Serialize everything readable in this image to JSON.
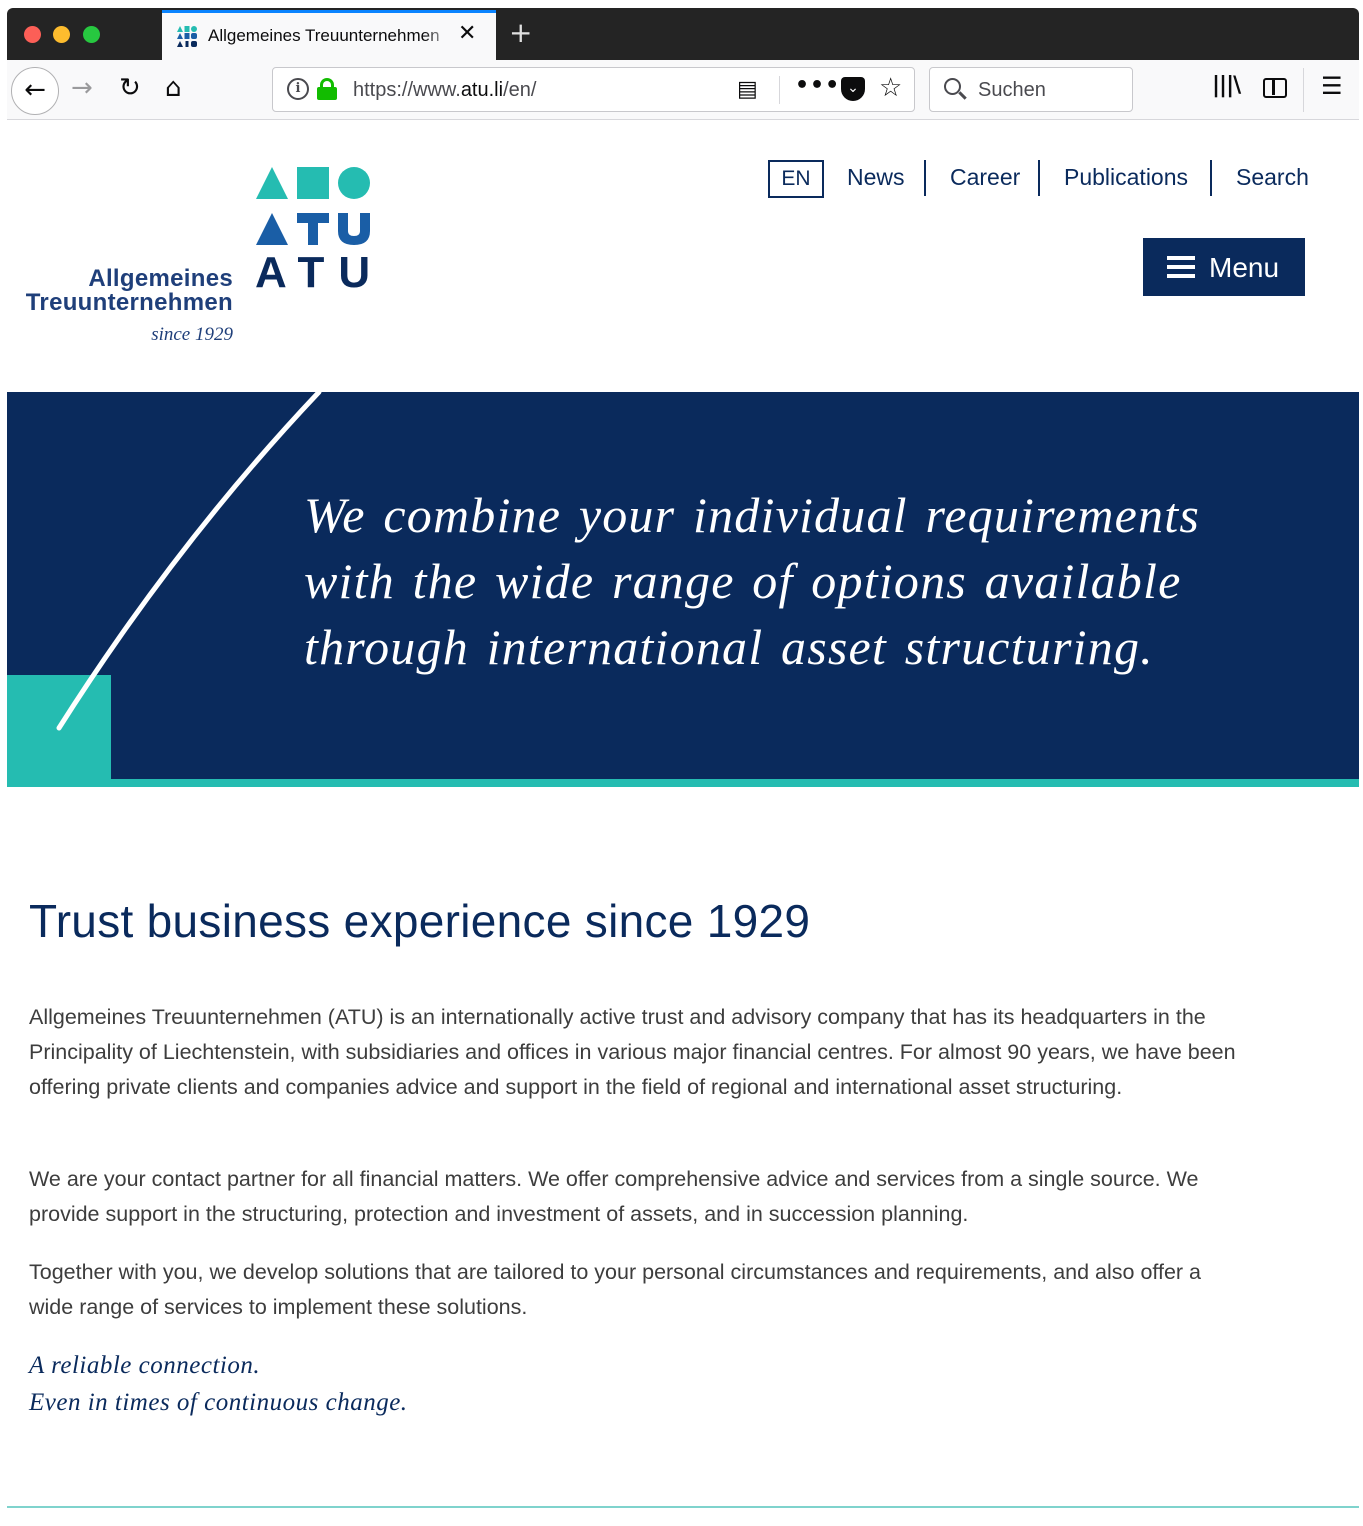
{
  "browser": {
    "tab_title": "Allgemeines Treuunternehmen",
    "tab_close": "✕",
    "new_tab": "+",
    "url_prefix": "https://www.",
    "url_domain": "atu.li",
    "url_path": "/en/",
    "search_placeholder": "Suchen",
    "page_actions_more": "•••",
    "icons": [
      "back-arrow-icon",
      "forward-arrow-icon",
      "reload-icon",
      "home-icon",
      "info-icon",
      "lock-icon",
      "reader-view-icon",
      "more-actions-icon",
      "pocket-icon",
      "bookmark-star-icon",
      "search-icon",
      "library-icon",
      "sidebar-icon",
      "hamburger-menu-icon"
    ]
  },
  "header": {
    "brand_line1": "Allgemeines",
    "brand_line2": "Treuunternehmen",
    "brand_since": "since 1929",
    "logo_letters": "ATU",
    "language": "EN",
    "nav": [
      "News",
      "Career",
      "Publications",
      "Search"
    ],
    "menu_label": "Menu"
  },
  "hero": {
    "quote": "We combine your individual requirements with the wide range of options available through international asset structuring."
  },
  "main": {
    "heading": "Trust business experience since 1929",
    "paragraphs": [
      "Allgemeines Treuunternehmen (ATU) is an internationally active trust and advisory company that has its headquarters in the Principality of Liechtenstein, with subsidiaries and offices in various major financial centres. For almost 90 years, we have been offering private clients and companies advice and support in the field of regional and international asset structuring.",
      "We are your contact partner for all financial matters. We offer comprehensive advice and services from a single source. We provide support in the structuring, protection and investment of assets, and in succession planning.",
      "Together with you, we develop solutions that are tailored to your personal circumstances and requirements, and also offer a wide range of services to implement these solutions."
    ],
    "slogan_line1": "A reliable connection.",
    "slogan_line2": "Even in times of continuous change."
  },
  "colors": {
    "navy": "#0a2a5c",
    "teal": "#25bcb1",
    "logo_dark_blue": "#1a5ea6",
    "body_text": "#3d3d3d"
  }
}
